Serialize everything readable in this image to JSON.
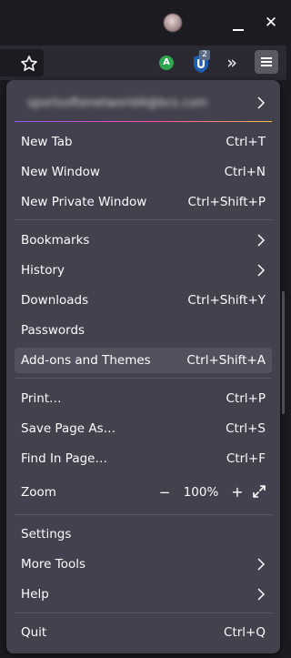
{
  "window": {
    "close_glyph": "✕",
    "minimize_glyph": "—"
  },
  "toolbar": {
    "extension_a_label": "A",
    "ublock_badge": "2",
    "overflow_glyph": "»"
  },
  "menu": {
    "account_email": "sportsoftenetworld4@bcs.com",
    "items": [
      {
        "label": "New Tab",
        "shortcut": "Ctrl+T"
      },
      {
        "label": "New Window",
        "shortcut": "Ctrl+N"
      },
      {
        "label": "New Private Window",
        "shortcut": "Ctrl+Shift+P"
      },
      {
        "label": "Bookmarks"
      },
      {
        "label": "History"
      },
      {
        "label": "Downloads",
        "shortcut": "Ctrl+Shift+Y"
      },
      {
        "label": "Passwords"
      },
      {
        "label": "Add-ons and Themes",
        "shortcut": "Ctrl+Shift+A"
      },
      {
        "label": "Print…",
        "shortcut": "Ctrl+P"
      },
      {
        "label": "Save Page As…",
        "shortcut": "Ctrl+S"
      },
      {
        "label": "Find In Page…",
        "shortcut": "Ctrl+F"
      },
      {
        "label": "Settings"
      },
      {
        "label": "More Tools"
      },
      {
        "label": "Help"
      },
      {
        "label": "Quit",
        "shortcut": "Ctrl+Q"
      }
    ],
    "zoom": {
      "label": "Zoom",
      "minus": "−",
      "level": "100%",
      "plus": "+"
    }
  },
  "icons": [
    "star-icon",
    "chevron-right-icon",
    "fullscreen-icon",
    "hamburger-menu-icon",
    "ublock-origin-icon"
  ],
  "colors": {
    "panel_background": "#42414d",
    "hover_background": "#52525e",
    "text": "#fbfbfe",
    "gradient_start": "#9059ff",
    "gradient_end": "#ffbd4f"
  }
}
